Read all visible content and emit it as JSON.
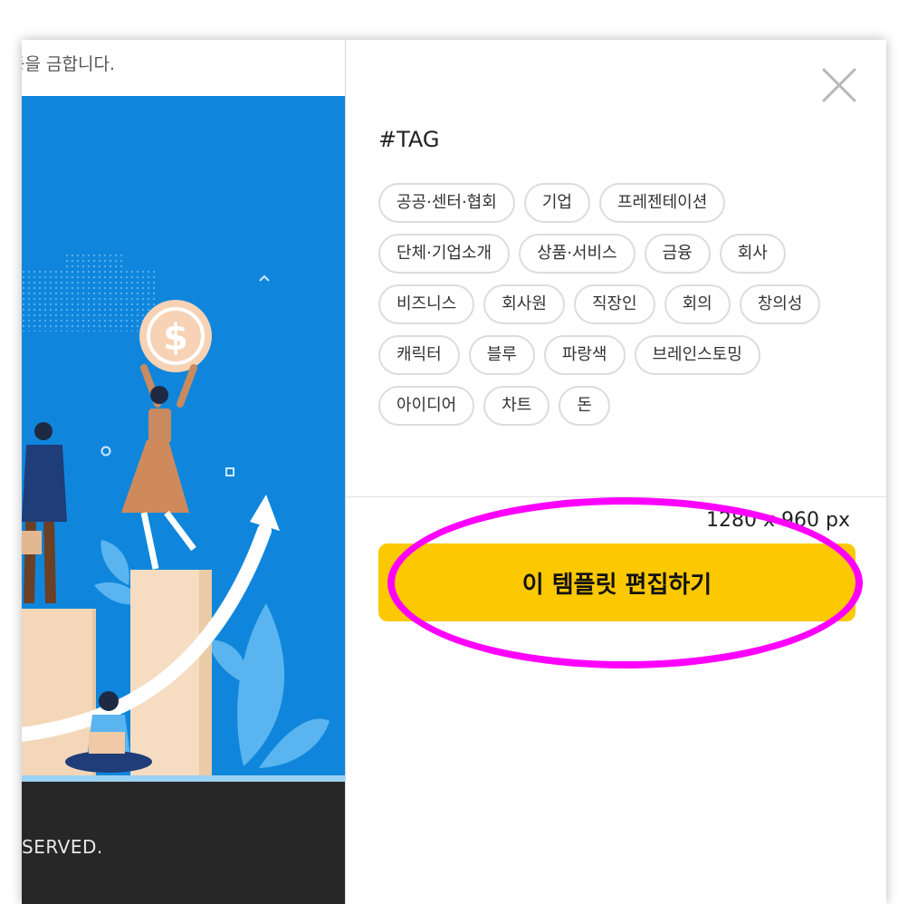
{
  "preview": {
    "notice_text": "등을 금합니다.",
    "footer_text": "SERVED."
  },
  "detail": {
    "close_icon": "close-icon",
    "tag_heading": "#TAG",
    "tags": [
      "공공·센터·협회",
      "기업",
      "프레젠테이션",
      "단체·기업소개",
      "상품·서비스",
      "금융",
      "회사",
      "비즈니스",
      "회사원",
      "직장인",
      "회의",
      "창의성",
      "캐릭터",
      "블루",
      "파랑색",
      "브레인스토밍",
      "아이디어",
      "차트",
      "돈"
    ],
    "size_text": "1280 x 960 px",
    "edit_button_label": "이 템플릿 편집하기"
  },
  "colors": {
    "accent_button": "#fcc800",
    "illustration_bg": "#0f86dc",
    "annotation": "#ff00ff"
  }
}
